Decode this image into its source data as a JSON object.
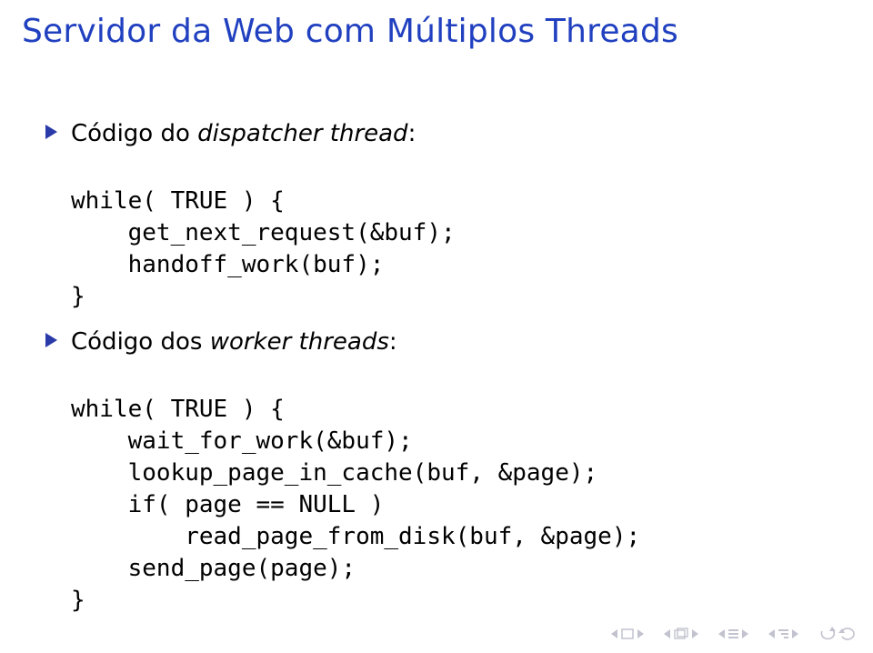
{
  "title": "Servidor da Web com Múltiplos Threads",
  "items": [
    {
      "lead": "Código do ",
      "emph": "dispatcher thread",
      "tail": ":",
      "code": [
        "while( TRUE ) {",
        "    get_next_request(&buf);",
        "    handoff_work(buf);",
        "}"
      ]
    },
    {
      "lead": "Código dos ",
      "emph": "worker threads",
      "tail": ":",
      "code": [
        "while( TRUE ) {",
        "    wait_for_work(&buf);",
        "    lookup_page_in_cache(buf, &page);",
        "    if( page == NULL )",
        "        read_page_from_disk(buf, &page);",
        "    send_page(page);",
        "}"
      ]
    }
  ]
}
